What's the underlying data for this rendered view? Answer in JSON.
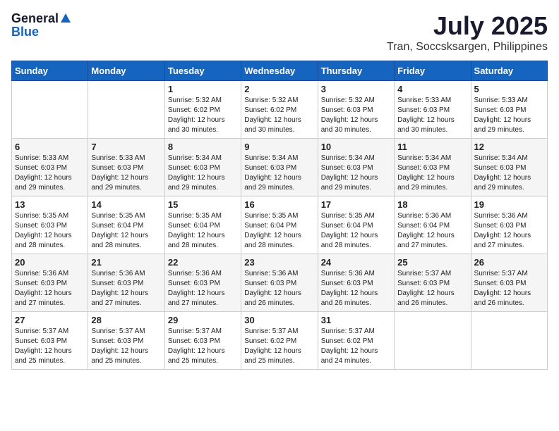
{
  "header": {
    "logo_general": "General",
    "logo_blue": "Blue",
    "month_title": "July 2025",
    "location": "Tran, Soccsksargen, Philippines"
  },
  "weekdays": [
    "Sunday",
    "Monday",
    "Tuesday",
    "Wednesday",
    "Thursday",
    "Friday",
    "Saturday"
  ],
  "weeks": [
    [
      {
        "day": "",
        "detail": ""
      },
      {
        "day": "",
        "detail": ""
      },
      {
        "day": "1",
        "detail": "Sunrise: 5:32 AM\nSunset: 6:02 PM\nDaylight: 12 hours and 30 minutes."
      },
      {
        "day": "2",
        "detail": "Sunrise: 5:32 AM\nSunset: 6:02 PM\nDaylight: 12 hours and 30 minutes."
      },
      {
        "day": "3",
        "detail": "Sunrise: 5:32 AM\nSunset: 6:03 PM\nDaylight: 12 hours and 30 minutes."
      },
      {
        "day": "4",
        "detail": "Sunrise: 5:33 AM\nSunset: 6:03 PM\nDaylight: 12 hours and 30 minutes."
      },
      {
        "day": "5",
        "detail": "Sunrise: 5:33 AM\nSunset: 6:03 PM\nDaylight: 12 hours and 29 minutes."
      }
    ],
    [
      {
        "day": "6",
        "detail": "Sunrise: 5:33 AM\nSunset: 6:03 PM\nDaylight: 12 hours and 29 minutes."
      },
      {
        "day": "7",
        "detail": "Sunrise: 5:33 AM\nSunset: 6:03 PM\nDaylight: 12 hours and 29 minutes."
      },
      {
        "day": "8",
        "detail": "Sunrise: 5:34 AM\nSunset: 6:03 PM\nDaylight: 12 hours and 29 minutes."
      },
      {
        "day": "9",
        "detail": "Sunrise: 5:34 AM\nSunset: 6:03 PM\nDaylight: 12 hours and 29 minutes."
      },
      {
        "day": "10",
        "detail": "Sunrise: 5:34 AM\nSunset: 6:03 PM\nDaylight: 12 hours and 29 minutes."
      },
      {
        "day": "11",
        "detail": "Sunrise: 5:34 AM\nSunset: 6:03 PM\nDaylight: 12 hours and 29 minutes."
      },
      {
        "day": "12",
        "detail": "Sunrise: 5:34 AM\nSunset: 6:03 PM\nDaylight: 12 hours and 29 minutes."
      }
    ],
    [
      {
        "day": "13",
        "detail": "Sunrise: 5:35 AM\nSunset: 6:03 PM\nDaylight: 12 hours and 28 minutes."
      },
      {
        "day": "14",
        "detail": "Sunrise: 5:35 AM\nSunset: 6:04 PM\nDaylight: 12 hours and 28 minutes."
      },
      {
        "day": "15",
        "detail": "Sunrise: 5:35 AM\nSunset: 6:04 PM\nDaylight: 12 hours and 28 minutes."
      },
      {
        "day": "16",
        "detail": "Sunrise: 5:35 AM\nSunset: 6:04 PM\nDaylight: 12 hours and 28 minutes."
      },
      {
        "day": "17",
        "detail": "Sunrise: 5:35 AM\nSunset: 6:04 PM\nDaylight: 12 hours and 28 minutes."
      },
      {
        "day": "18",
        "detail": "Sunrise: 5:36 AM\nSunset: 6:04 PM\nDaylight: 12 hours and 27 minutes."
      },
      {
        "day": "19",
        "detail": "Sunrise: 5:36 AM\nSunset: 6:03 PM\nDaylight: 12 hours and 27 minutes."
      }
    ],
    [
      {
        "day": "20",
        "detail": "Sunrise: 5:36 AM\nSunset: 6:03 PM\nDaylight: 12 hours and 27 minutes."
      },
      {
        "day": "21",
        "detail": "Sunrise: 5:36 AM\nSunset: 6:03 PM\nDaylight: 12 hours and 27 minutes."
      },
      {
        "day": "22",
        "detail": "Sunrise: 5:36 AM\nSunset: 6:03 PM\nDaylight: 12 hours and 27 minutes."
      },
      {
        "day": "23",
        "detail": "Sunrise: 5:36 AM\nSunset: 6:03 PM\nDaylight: 12 hours and 26 minutes."
      },
      {
        "day": "24",
        "detail": "Sunrise: 5:36 AM\nSunset: 6:03 PM\nDaylight: 12 hours and 26 minutes."
      },
      {
        "day": "25",
        "detail": "Sunrise: 5:37 AM\nSunset: 6:03 PM\nDaylight: 12 hours and 26 minutes."
      },
      {
        "day": "26",
        "detail": "Sunrise: 5:37 AM\nSunset: 6:03 PM\nDaylight: 12 hours and 26 minutes."
      }
    ],
    [
      {
        "day": "27",
        "detail": "Sunrise: 5:37 AM\nSunset: 6:03 PM\nDaylight: 12 hours and 25 minutes."
      },
      {
        "day": "28",
        "detail": "Sunrise: 5:37 AM\nSunset: 6:03 PM\nDaylight: 12 hours and 25 minutes."
      },
      {
        "day": "29",
        "detail": "Sunrise: 5:37 AM\nSunset: 6:03 PM\nDaylight: 12 hours and 25 minutes."
      },
      {
        "day": "30",
        "detail": "Sunrise: 5:37 AM\nSunset: 6:02 PM\nDaylight: 12 hours and 25 minutes."
      },
      {
        "day": "31",
        "detail": "Sunrise: 5:37 AM\nSunset: 6:02 PM\nDaylight: 12 hours and 24 minutes."
      },
      {
        "day": "",
        "detail": ""
      },
      {
        "day": "",
        "detail": ""
      }
    ]
  ]
}
